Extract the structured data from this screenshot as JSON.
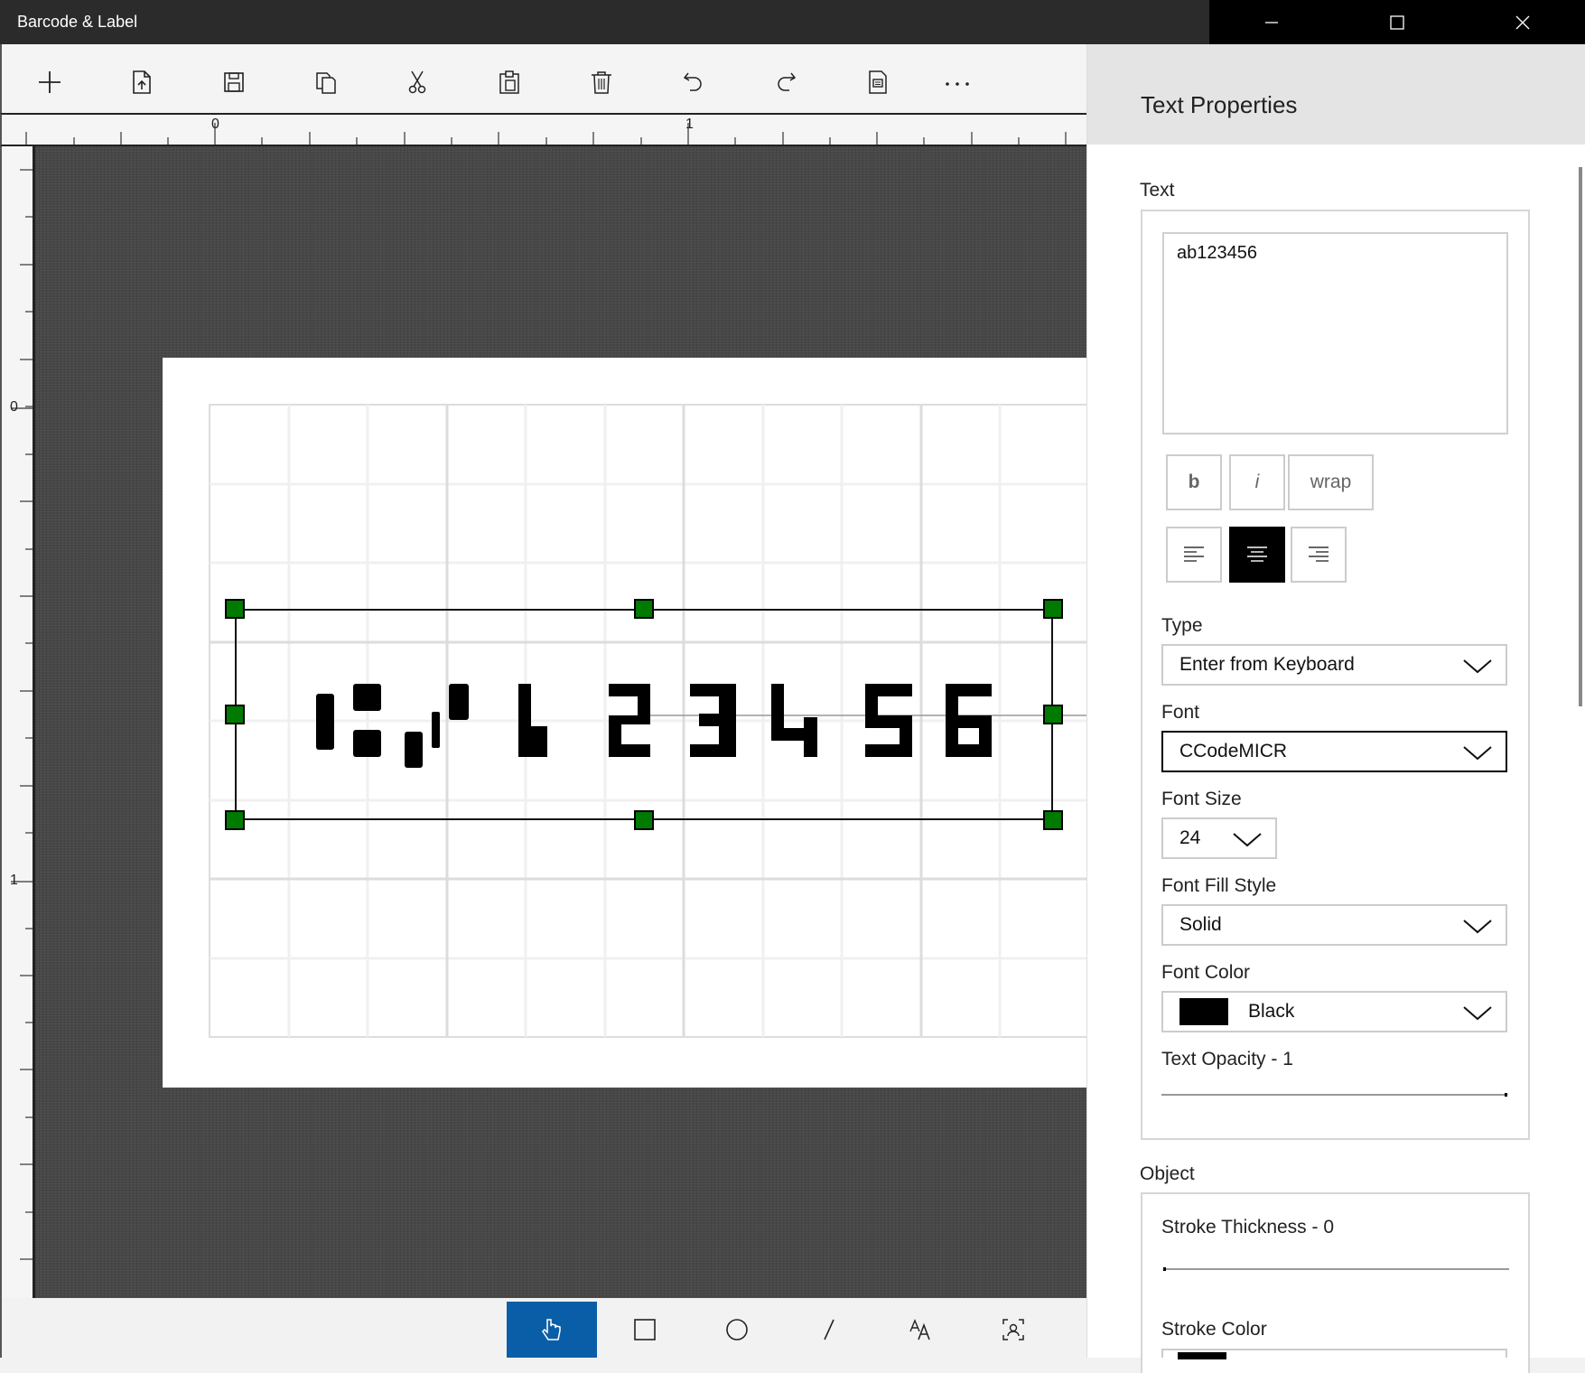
{
  "window": {
    "title": "Barcode & Label"
  },
  "toolbar": {
    "buttons": [
      "new-icon",
      "import-icon",
      "save-icon",
      "copy-icon",
      "cut-icon",
      "paste-icon",
      "delete-icon",
      "undo-icon",
      "redo-icon",
      "print-icon",
      "more-icon"
    ]
  },
  "rulers": {
    "h_labels": [
      "0",
      "1"
    ],
    "v_labels": [
      "0",
      "1"
    ]
  },
  "label_object": {
    "text": "ab123456"
  },
  "bottom_tools": [
    "select-tool-icon",
    "rectangle-tool-icon",
    "ellipse-tool-icon",
    "line-tool-icon",
    "text-tool-icon",
    "barcode-tool-icon"
  ],
  "panel": {
    "title": "Text Properties",
    "text_section": "Text",
    "text_value": "ab123456",
    "bold_label": "b",
    "italic_label": "i",
    "wrap_label": "wrap",
    "type_label": "Type",
    "type_value": "Enter from Keyboard",
    "font_label": "Font",
    "font_value": "CCodeMICR",
    "font_size_label": "Font Size",
    "font_size_value": "24",
    "fill_style_label": "Font Fill Style",
    "fill_style_value": "Solid",
    "font_color_label": "Font Color",
    "font_color_value": "Black",
    "font_color_hex": "#000000",
    "opacity_label": "Text Opacity - 1",
    "opacity_value": 1,
    "object_section": "Object",
    "stroke_thickness_label": "Stroke Thickness - 0",
    "stroke_thickness_value": 0,
    "stroke_color_label": "Stroke Color"
  },
  "colors": {
    "accent": "#0a5ea8",
    "handle": "#007a00"
  }
}
